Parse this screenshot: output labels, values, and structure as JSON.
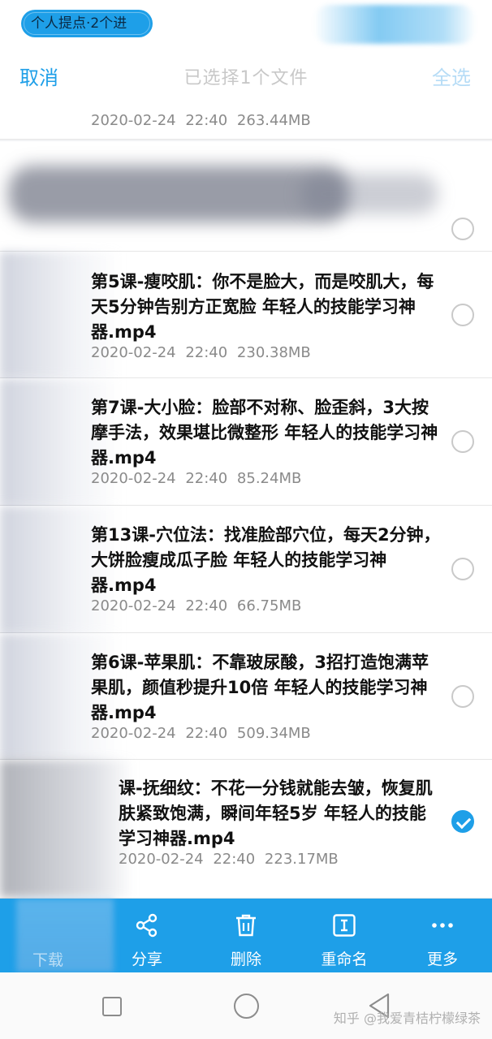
{
  "status_pill": "个人提点·2个进",
  "header": {
    "cancel_label": "取消",
    "title": "已选择1个文件",
    "select_all_label": "全选"
  },
  "files": [
    {
      "name": "",
      "meta": "2020-02-24  22:40  263.44MB",
      "selected": false
    },
    {
      "name": "",
      "meta": "",
      "selected": false
    },
    {
      "name": "第5课-瘦咬肌：你不是脸大，而是咬肌大，每天5分钟告别方正宽脸  年轻人的技能学习神器.mp4",
      "meta": "2020-02-24  22:40  230.38MB",
      "selected": false
    },
    {
      "name": "第7课-大小脸：脸部不对称、脸歪斜，3大按摩手法，效果堪比微整形  年轻人的技能学习神器.mp4",
      "meta": "2020-02-24  22:40  85.24MB",
      "selected": false
    },
    {
      "name": "第13课-穴位法：找准脸部穴位，每天2分钟，大饼脸瘦成瓜子脸  年轻人的技能学习神器.mp4",
      "meta": "2020-02-24  22:40  66.75MB",
      "selected": false
    },
    {
      "name": "第6课-苹果肌：不靠玻尿酸，3招打造饱满苹果肌，颜值秒提升10倍  年轻人的技能学习神器.mp4",
      "meta": "2020-02-24  22:40  509.34MB",
      "selected": false
    },
    {
      "name": "课-抚细纹：不花一分钱就能去皱，恢复肌肤紧致饱满，瞬间年轻5岁  年轻人的技能学习神器.mp4",
      "meta": "2020-02-24  22:40  223.17MB",
      "selected": true
    }
  ],
  "toolbar": {
    "download_label": "下载",
    "share_label": "分享",
    "delete_label": "删除",
    "rename_label": "重命名",
    "more_label": "更多"
  },
  "watermark": "知乎 @我爱青桔柠檬绿茶"
}
